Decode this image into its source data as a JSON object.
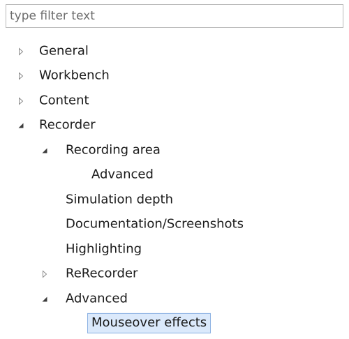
{
  "filter": {
    "placeholder": "type filter text",
    "value": ""
  },
  "tree": {
    "items": [
      {
        "label": "General",
        "level": 0,
        "twisty": "collapsed",
        "selected": false
      },
      {
        "label": "Workbench",
        "level": 0,
        "twisty": "collapsed",
        "selected": false
      },
      {
        "label": "Content",
        "level": 0,
        "twisty": "collapsed",
        "selected": false
      },
      {
        "label": "Recorder",
        "level": 0,
        "twisty": "expanded",
        "selected": false
      },
      {
        "label": "Recording area",
        "level": 1,
        "twisty": "expanded",
        "selected": false
      },
      {
        "label": "Advanced",
        "level": 2,
        "twisty": "none",
        "selected": false
      },
      {
        "label": "Simulation depth",
        "level": 1,
        "twisty": "none",
        "selected": false
      },
      {
        "label": "Documentation/Screenshots",
        "level": 1,
        "twisty": "none",
        "selected": false
      },
      {
        "label": "Highlighting",
        "level": 1,
        "twisty": "none",
        "selected": false
      },
      {
        "label": "ReRecorder",
        "level": 1,
        "twisty": "collapsed",
        "selected": false
      },
      {
        "label": "Advanced",
        "level": 1,
        "twisty": "expanded",
        "selected": false
      },
      {
        "label": "Mouseover effects",
        "level": 2,
        "twisty": "none",
        "selected": true
      }
    ]
  },
  "colors": {
    "selection_fill": "#dbe9fb",
    "selection_border": "#8db2e3",
    "twisty": "#8a8a8a",
    "twisty_expanded": "#3c3c3c"
  }
}
